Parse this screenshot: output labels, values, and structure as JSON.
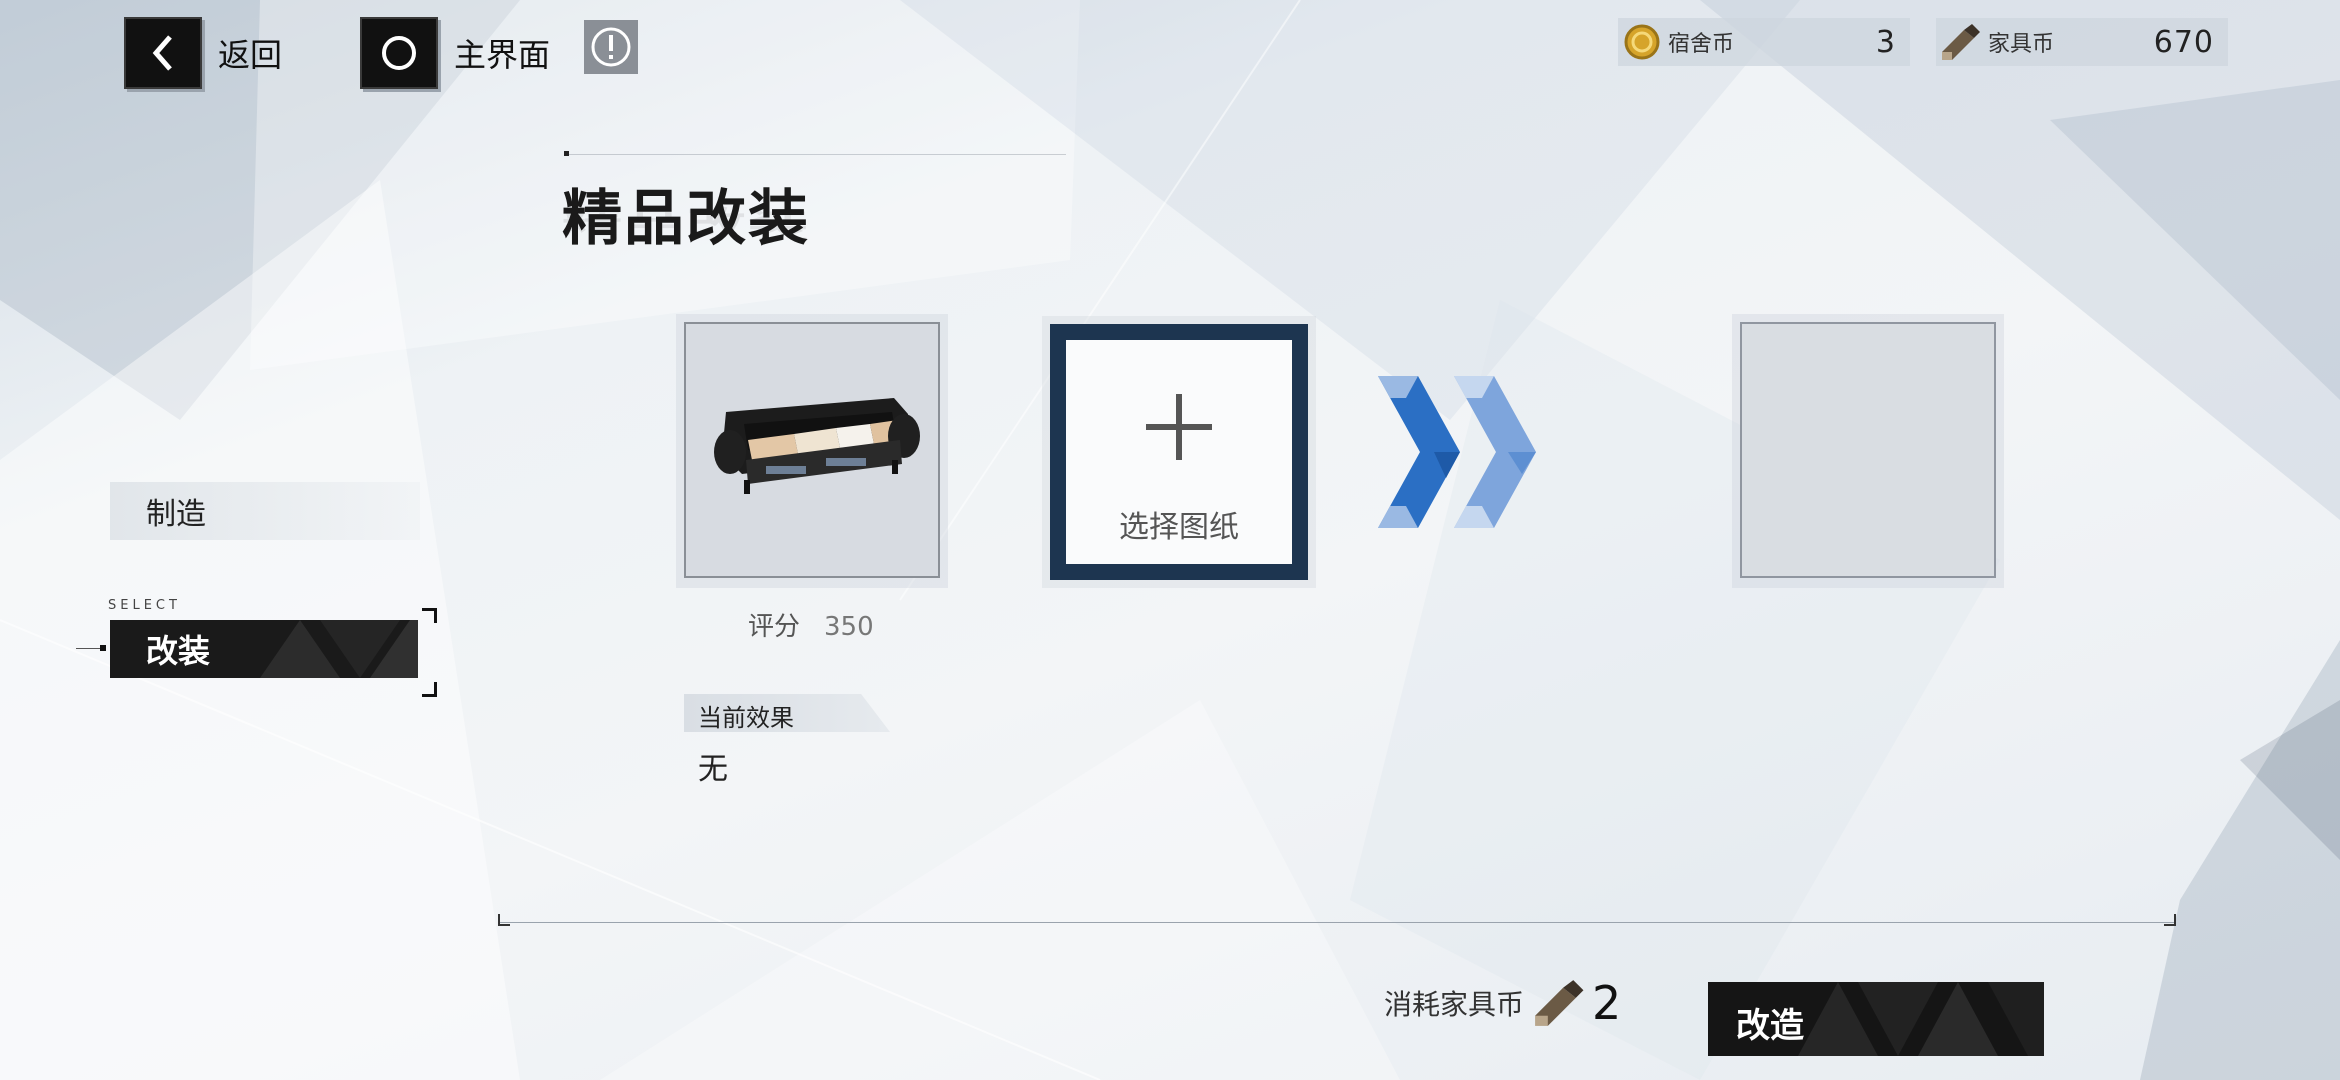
{
  "topbar": {
    "back_label": "返回",
    "home_label": "主界面"
  },
  "currencies": [
    {
      "name": "宿舍币",
      "value": "3",
      "icon": "dorm-coin-icon",
      "color": "#d6a42a"
    },
    {
      "name": "家具币",
      "value": "670",
      "icon": "furniture-coin-icon",
      "color": "#6b5a45"
    }
  ],
  "page": {
    "title": "精品改装"
  },
  "menu": {
    "make_label": "制造",
    "select_tag": "SELECT",
    "modify_label": "改装"
  },
  "workbench": {
    "item_icon": "sofa-icon",
    "score_label": "评分",
    "score_value": "350",
    "blueprint_label": "选择图纸",
    "effect_title": "当前效果",
    "effect_value": "无"
  },
  "footer": {
    "cost_label": "消耗家具币",
    "cost_value": "2",
    "action_label": "改造"
  },
  "colors": {
    "accent_blue": "#2b6fc4",
    "dark_navy": "#1d3550",
    "button_dark": "#151515"
  }
}
